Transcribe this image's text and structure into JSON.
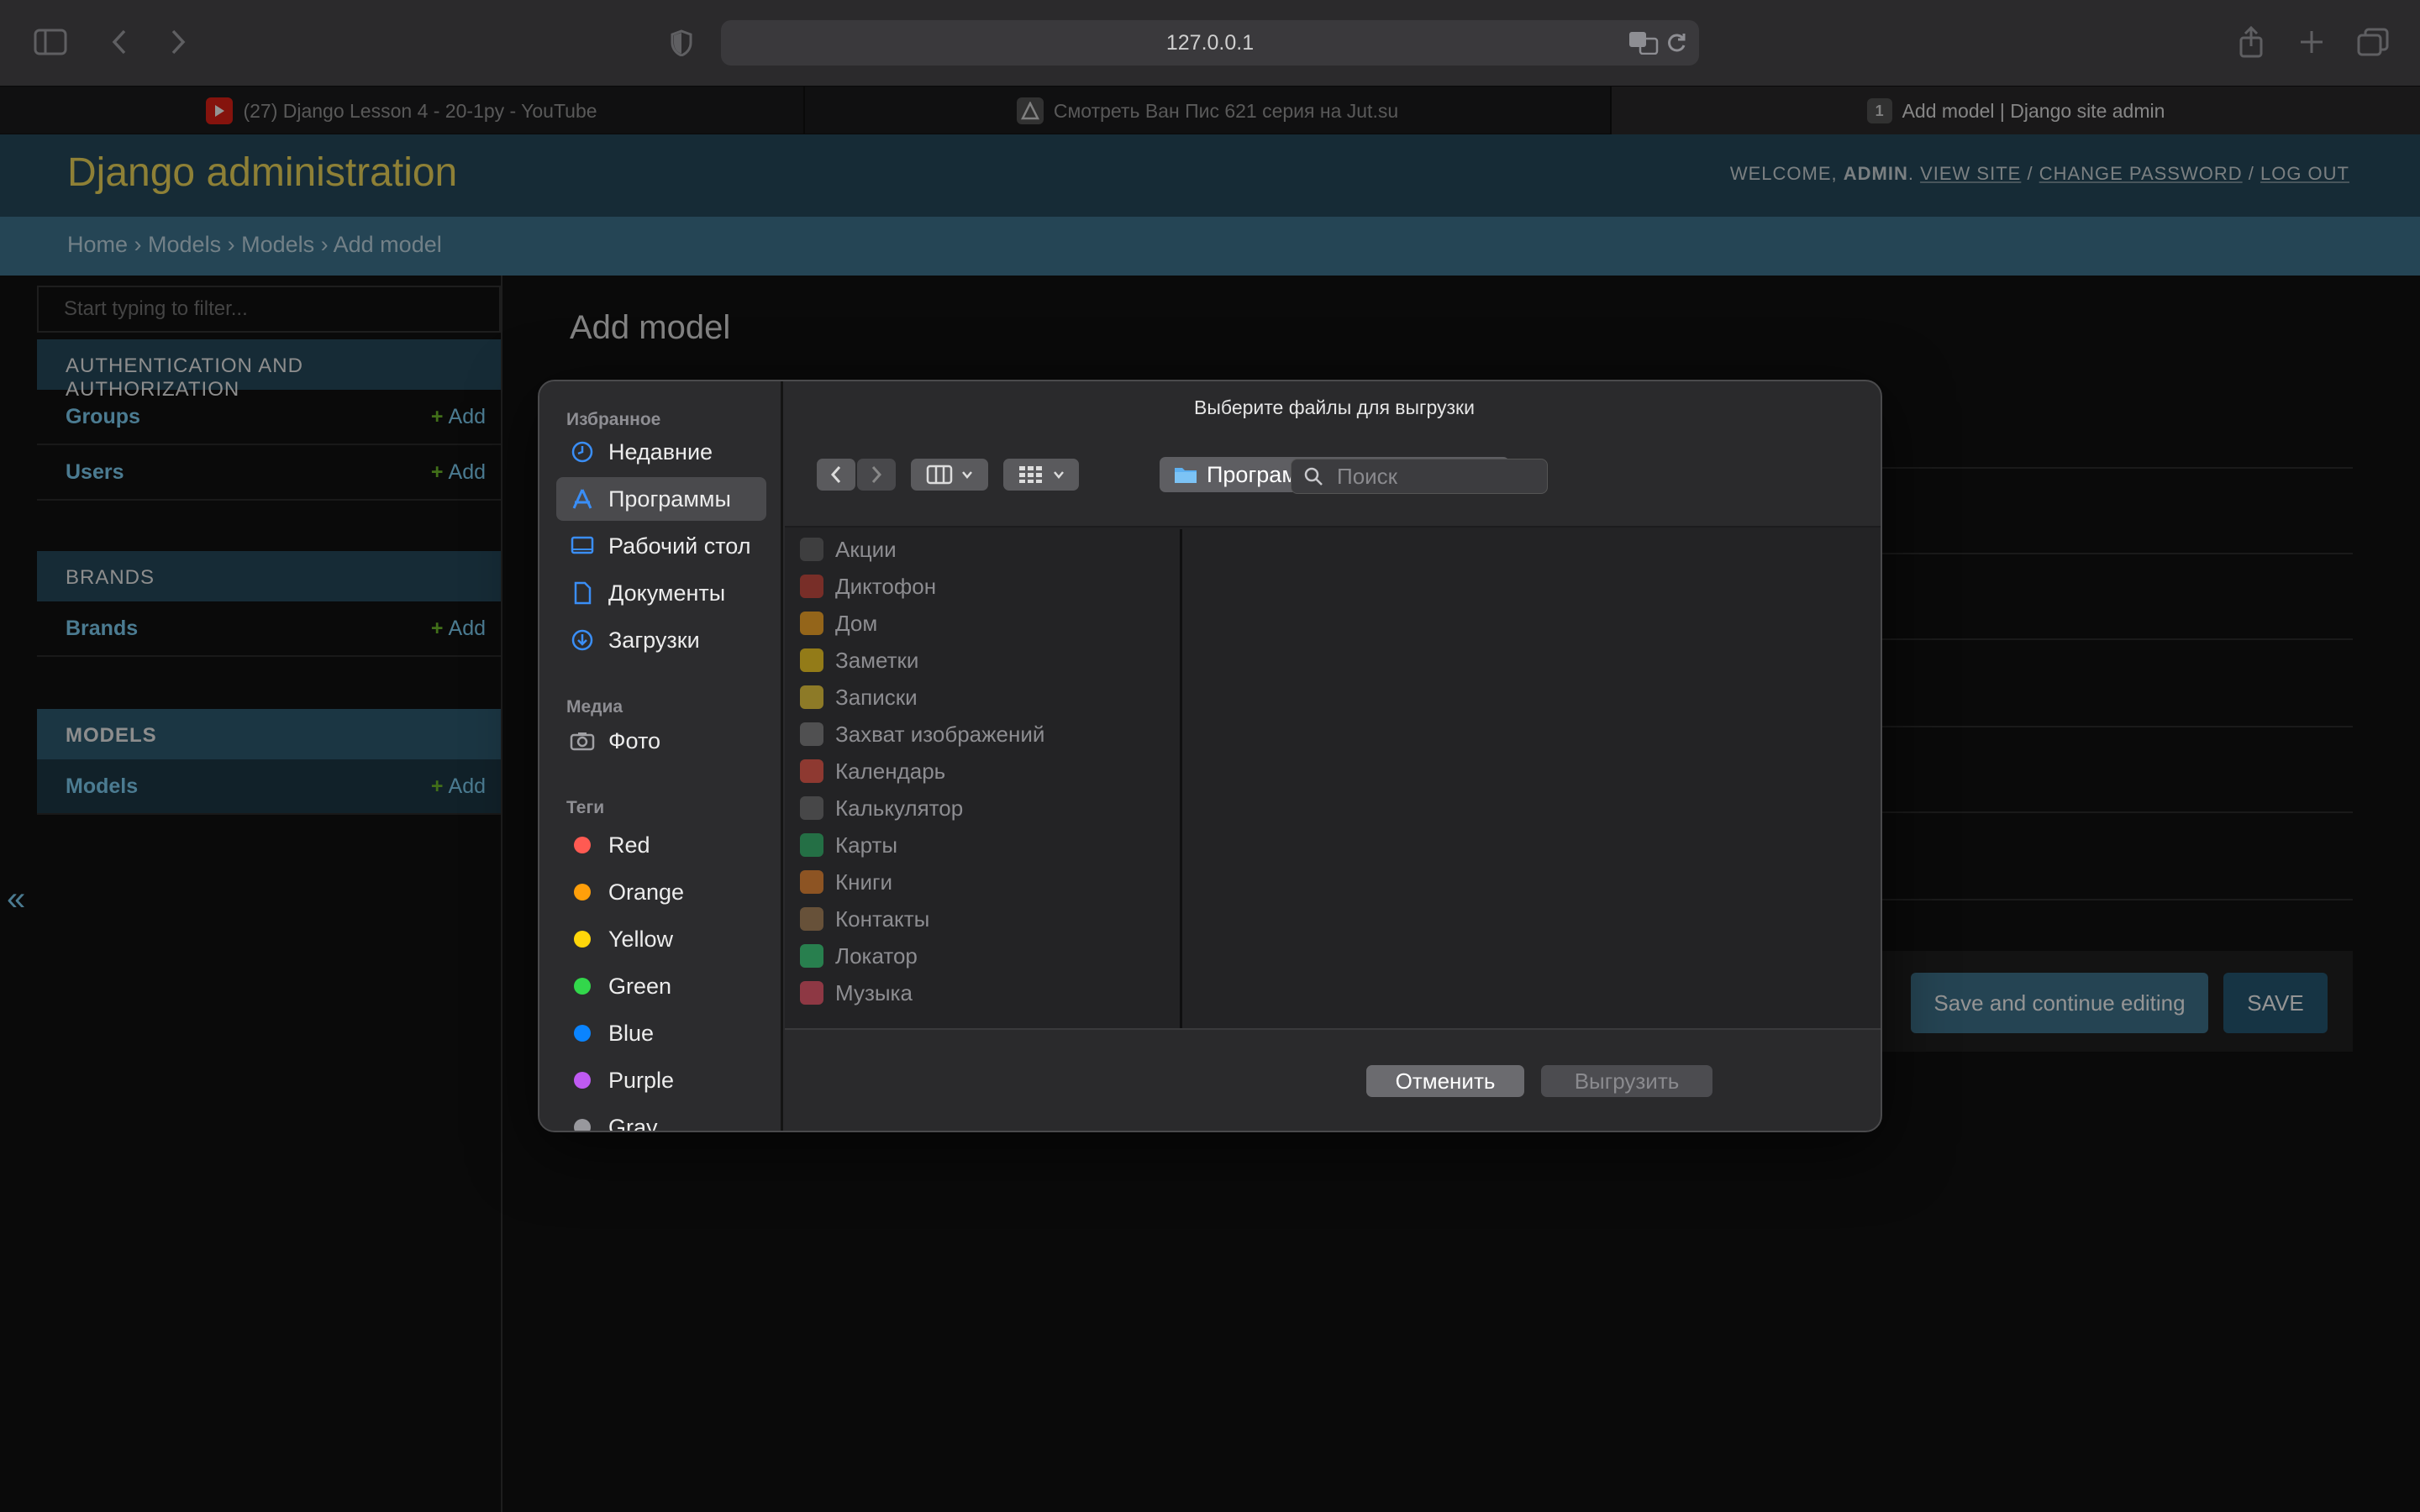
{
  "browser": {
    "url": "127.0.0.1",
    "tabs": [
      {
        "label": "(27) Django Lesson 4 - 20-1py - YouTube",
        "badge": ""
      },
      {
        "label": "Смотреть Ван Пис 621 серия на Jut.su",
        "badge": ""
      },
      {
        "label": "Add model | Django site admin",
        "badge": "1"
      }
    ]
  },
  "admin": {
    "brand": "Django administration",
    "welcome": "WELCOME,",
    "username": "ADMIN",
    "view_site": "VIEW SITE",
    "change_password": "CHANGE PASSWORD",
    "log_out": "LOG OUT",
    "breadcrumb": [
      "Home",
      "Models",
      "Models",
      "Add model"
    ],
    "filter_placeholder": "Start typing to filter...",
    "apps": [
      {
        "caption": "AUTHENTICATION AND AUTHORIZATION",
        "models": [
          {
            "name": "Groups",
            "add": "Add"
          },
          {
            "name": "Users",
            "add": "Add"
          }
        ]
      },
      {
        "caption": "BRANDS",
        "models": [
          {
            "name": "Brands",
            "add": "Add"
          }
        ]
      },
      {
        "caption": "MODELS",
        "models": [
          {
            "name": "Models",
            "add": "Add"
          }
        ]
      }
    ],
    "collapse": "«",
    "page_title": "Add model",
    "buttons": {
      "save_continue": "Save and continue editing",
      "save": "SAVE"
    }
  },
  "dialog": {
    "title": "Выберите файлы для выгрузки",
    "sections": {
      "favorites": "Избранное",
      "media": "Медиа",
      "tags": "Теги"
    },
    "favorites": [
      "Недавние",
      "Программы",
      "Рабочий стол",
      "Документы",
      "Загрузки"
    ],
    "media": [
      "Фото"
    ],
    "tags": [
      {
        "label": "Red",
        "color": "#ff5a52"
      },
      {
        "label": "Orange",
        "color": "#ff9f0a"
      },
      {
        "label": "Yellow",
        "color": "#ffd60a"
      },
      {
        "label": "Green",
        "color": "#32d74b"
      },
      {
        "label": "Blue",
        "color": "#0a84ff"
      },
      {
        "label": "Purple",
        "color": "#bf5af2"
      },
      {
        "label": "Gray",
        "color": "#98989d"
      }
    ],
    "location": "Программы",
    "search_placeholder": "Поиск",
    "apps": [
      {
        "name": "Акции",
        "color": "#555"
      },
      {
        "name": "Диктофон",
        "color": "#c0392b"
      },
      {
        "name": "Дом",
        "color": "#f39c12"
      },
      {
        "name": "Заметки",
        "color": "#f1c40f"
      },
      {
        "name": "Записки",
        "color": "#e6c229"
      },
      {
        "name": "Захват изображений",
        "color": "#777"
      },
      {
        "name": "Календарь",
        "color": "#e74c3c"
      },
      {
        "name": "Калькулятор",
        "color": "#666"
      },
      {
        "name": "Карты",
        "color": "#27ae60"
      },
      {
        "name": "Книги",
        "color": "#e67e22"
      },
      {
        "name": "Контакты",
        "color": "#a0784a"
      },
      {
        "name": "Локатор",
        "color": "#2ecc71"
      },
      {
        "name": "Музыка",
        "color": "#e84a5f"
      }
    ],
    "cancel": "Отменить",
    "upload": "Выгрузить"
  }
}
